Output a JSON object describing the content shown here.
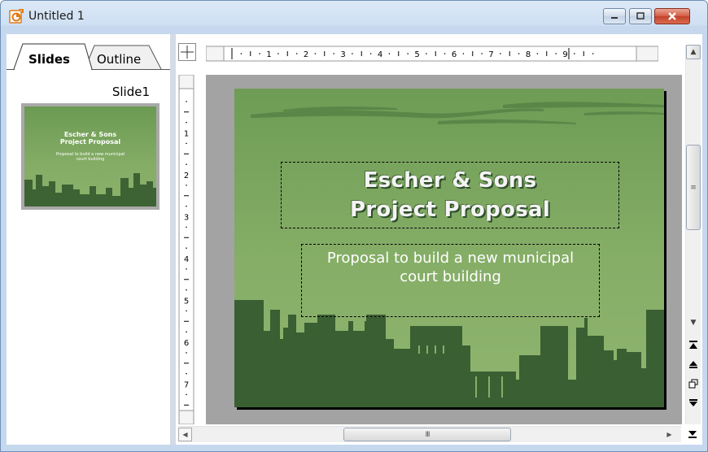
{
  "window": {
    "title": "Untitled 1",
    "app_icon": "impress-app-icon",
    "controls": [
      "minimize",
      "maximize",
      "close"
    ],
    "close_color": "#c9452f"
  },
  "slides_pane": {
    "tabs": [
      {
        "label": "Slides",
        "active": true
      },
      {
        "label": "Outline",
        "active": false
      }
    ],
    "slide_caption": "Slide1",
    "thumbnail": {
      "title_line1": "Escher & Sons",
      "title_line2": "Project Proposal",
      "subtitle_line1": "Proposal to build a new municipal",
      "subtitle_line2": "court building"
    }
  },
  "ruler": {
    "horizontal_labels": [
      "1",
      "2",
      "3",
      "4",
      "5",
      "6",
      "7",
      "8",
      "9"
    ],
    "vertical_labels": [
      "1",
      "2",
      "3",
      "4",
      "5",
      "6",
      "7"
    ]
  },
  "slide": {
    "title_line1": "Escher & Sons",
    "title_line2": "Project Proposal",
    "subtitle_line1": "Proposal to build a new municipal",
    "subtitle_line2": "court building",
    "background_color": "#7ea560",
    "skyline_color": "#3a5f32"
  },
  "scrollbar": {
    "vertical_thumb_grip": "≡",
    "horizontal_thumb_grip": "III",
    "nav_icons": [
      "first-slide-icon",
      "previous-slide-icon",
      "navigator-icon",
      "next-slide-icon",
      "last-slide-icon"
    ]
  }
}
